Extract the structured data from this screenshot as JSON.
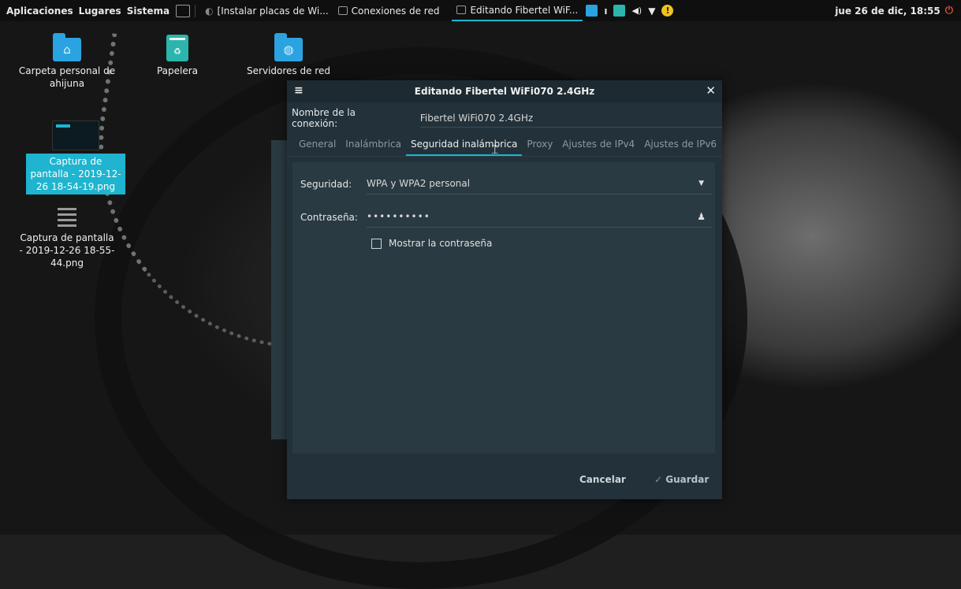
{
  "panel": {
    "menus": [
      "Aplicaciones",
      "Lugares",
      "Sistema"
    ],
    "tasks": [
      {
        "label": "[Instalar placas de Wi...",
        "active": false
      },
      {
        "label": "Conexiones de red",
        "active": false
      },
      {
        "label": "Editando Fibertel WiF...",
        "active": true
      }
    ],
    "clock": "jue 26 de dic, 18:55",
    "tray_colors": {
      "updates": "#2ba3e0",
      "vpn": "#2bb5ad",
      "warning": "#f2c21b",
      "power": "#e04a3a"
    }
  },
  "desktop": {
    "icons": [
      {
        "label": "Carpeta personal de ahijuna",
        "icon": "home-folder-icon"
      },
      {
        "label": "Papelera",
        "icon": "trash-icon"
      },
      {
        "label": "Servidores de red",
        "icon": "network-folder-icon"
      },
      {
        "label": "Captura de pantalla - 2019-12-26 18-54-19.png",
        "icon": "image-thumbnail-icon",
        "selected": true
      },
      {
        "label": "Captura de pantalla - 2019-12-26 18-55-44.png",
        "icon": "document-icon",
        "selected": false
      }
    ]
  },
  "dialog": {
    "title": "Editando Fibertel WiFi070 2.4GHz",
    "conn_name_label": "Nombre de la conexión:",
    "conn_name_value": "Fibertel WiFi070 2.4GHz",
    "tabs": [
      "General",
      "Inalámbrica",
      "Seguridad inalámbrica",
      "Proxy",
      "Ajustes de IPv4",
      "Ajustes de IPv6"
    ],
    "active_tab": "Seguridad inalámbrica",
    "security_label": "Seguridad:",
    "security_value": "WPA y WPA2 personal",
    "password_label": "Contraseña:",
    "password_value": "••••••••••",
    "show_password_label": "Mostrar la contraseña",
    "show_password_checked": false,
    "cancel_label": "Cancelar",
    "save_label": "Guardar"
  },
  "accent": "#1fb4cf"
}
